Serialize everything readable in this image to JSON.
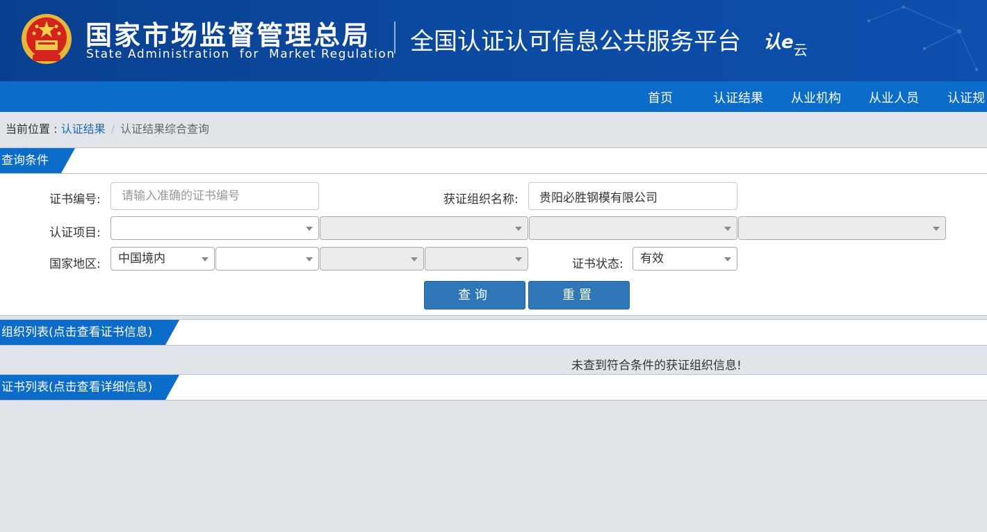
{
  "header": {
    "org_cn": "国家市场监督管理总局",
    "org_en": "State Administration  for  Market Regulation",
    "platform_title": "全国认证认可信息公共服务平台",
    "logo_text": "认",
    "logo_mark": "e",
    "logo_suffix": "云",
    "colors": {
      "header_bg": "#0b4aa0",
      "nav_bg": "#0b6dc9"
    }
  },
  "nav": {
    "items": [
      "首页",
      "认证结果",
      "从业机构",
      "从业人员",
      "认证规"
    ]
  },
  "breadcrumb": {
    "prefix": "当前位置 : ",
    "link": "认证结果",
    "separator": "/",
    "current": "认证结果综合查询"
  },
  "query_section": {
    "title": "查询条件",
    "cert_no_label": "证书编号:",
    "cert_no_placeholder": "请输入准确的证书编号",
    "cert_no_value": "",
    "org_name_label": "获证组织名称:",
    "org_name_value": "贵阳必胜钢模有限公司",
    "project_label": "认证项目:",
    "project_selects": [
      "",
      "",
      "",
      ""
    ],
    "region_label": "国家地区:",
    "region_selects": [
      "中国境内",
      "",
      "",
      ""
    ],
    "status_label": "证书状态:",
    "status_value": "有效",
    "search_button": "查询",
    "reset_button": "重置"
  },
  "org_list": {
    "title": "组织列表(点击查看证书信息)",
    "empty_message": "未查到符合条件的获证组织信息!"
  },
  "cert_list": {
    "title": "证书列表(点击查看详细信息)"
  }
}
